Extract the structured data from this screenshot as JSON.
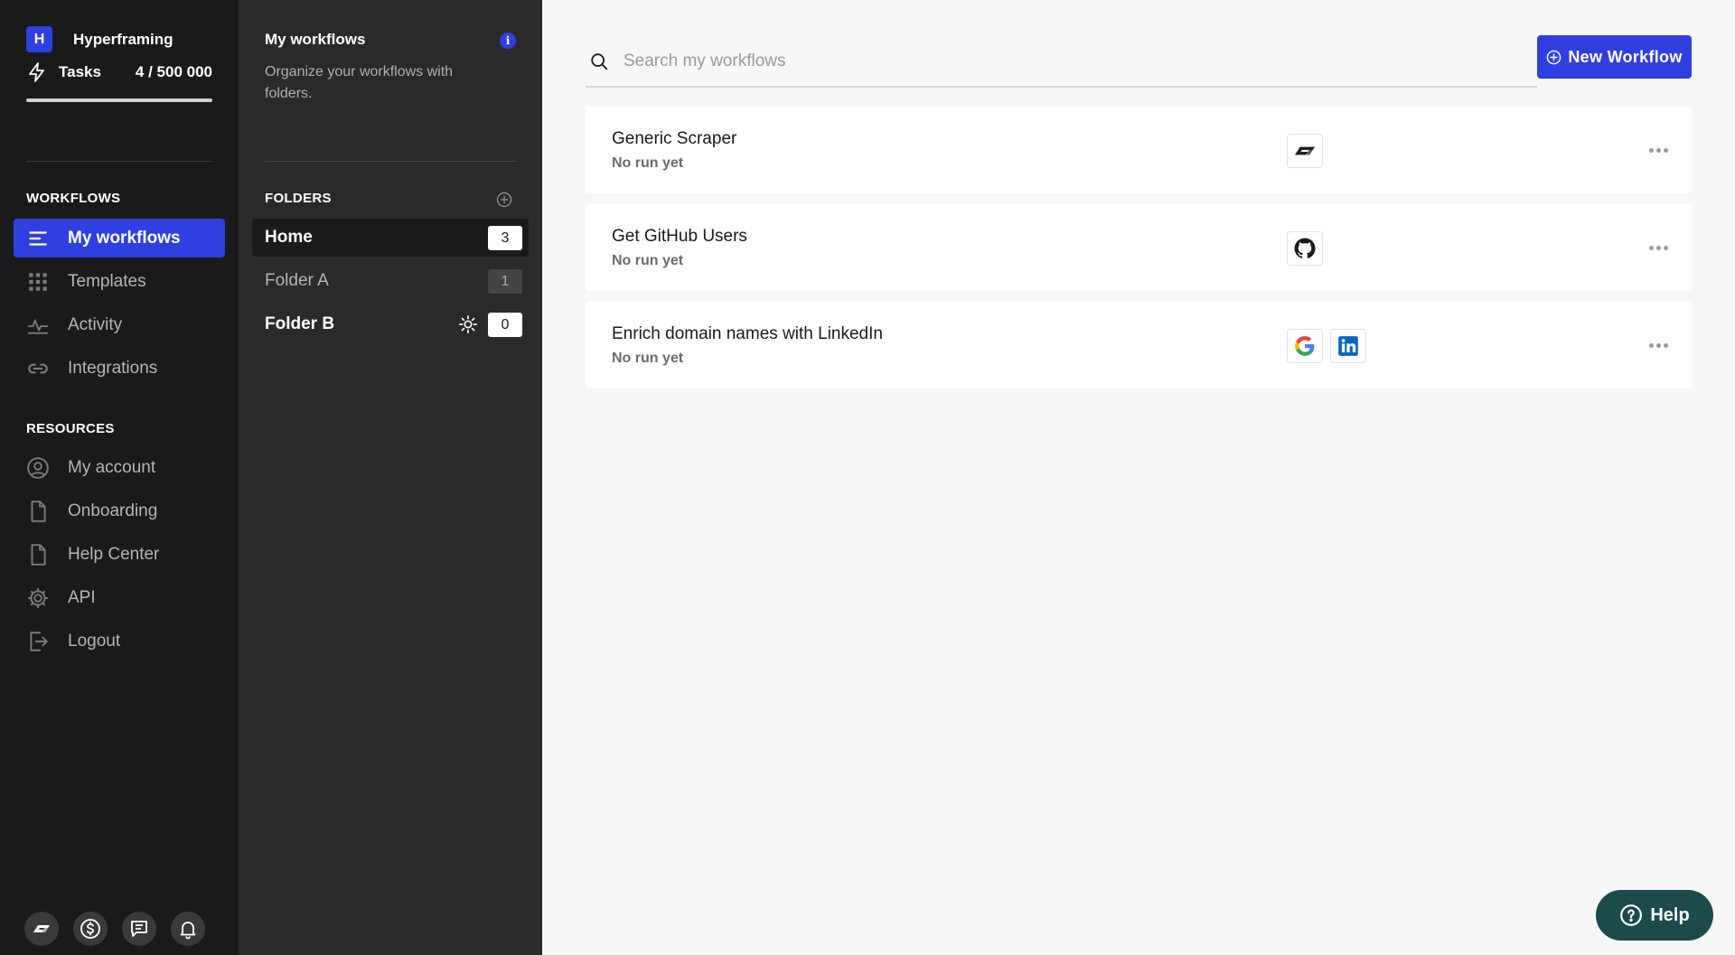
{
  "workspace": {
    "initial": "H",
    "name": "Hyperframing"
  },
  "tasks": {
    "label": "Tasks",
    "count": "4 / 500 000",
    "used_fraction": 8e-06
  },
  "sidebar": {
    "workflows_title": "WORKFLOWS",
    "workflows_items": [
      {
        "label": "My workflows",
        "icon": "list-icon",
        "active": true
      },
      {
        "label": "Templates",
        "icon": "grid-icon"
      },
      {
        "label": "Activity",
        "icon": "activity-icon"
      },
      {
        "label": "Integrations",
        "icon": "link-icon"
      }
    ],
    "resources_title": "RESOURCES",
    "resources_items": [
      {
        "label": "My account",
        "icon": "user-circle-icon"
      },
      {
        "label": "Onboarding",
        "icon": "document-icon"
      },
      {
        "label": "Help Center",
        "icon": "document-icon"
      },
      {
        "label": "API",
        "icon": "gear-icon"
      },
      {
        "label": "Logout",
        "icon": "logout-icon"
      }
    ],
    "bottom_icons": [
      "logo-icon",
      "dollar-icon",
      "chat-icon",
      "bell-icon"
    ]
  },
  "folder_panel": {
    "title": "My workflows",
    "description": "Organize your workflows with folders.",
    "section_title": "FOLDERS",
    "folders": [
      {
        "name": "Home",
        "count": "3",
        "active": true
      },
      {
        "name": "Folder A",
        "count": "1"
      },
      {
        "name": "Folder B",
        "count": "0",
        "has_settings": true
      }
    ]
  },
  "main": {
    "search_placeholder": "Search my workflows",
    "new_button_label": "New Workflow",
    "workflows": [
      {
        "name": "Generic Scraper",
        "status": "No run yet",
        "apps": [
          "hyperframing-logo-icon"
        ]
      },
      {
        "name": "Get GitHub Users",
        "status": "No run yet",
        "apps": [
          "github-icon"
        ]
      },
      {
        "name": "Enrich domain names with LinkedIn",
        "status": "No run yet",
        "apps": [
          "google-icon",
          "linkedin-icon"
        ]
      }
    ]
  },
  "help_button_label": "Help",
  "colors": {
    "accent": "#2f3fe0",
    "sidebar_bg": "#1a1a1a",
    "folder_bg": "#2a2a2a",
    "help_bg": "#1d4a4a"
  }
}
